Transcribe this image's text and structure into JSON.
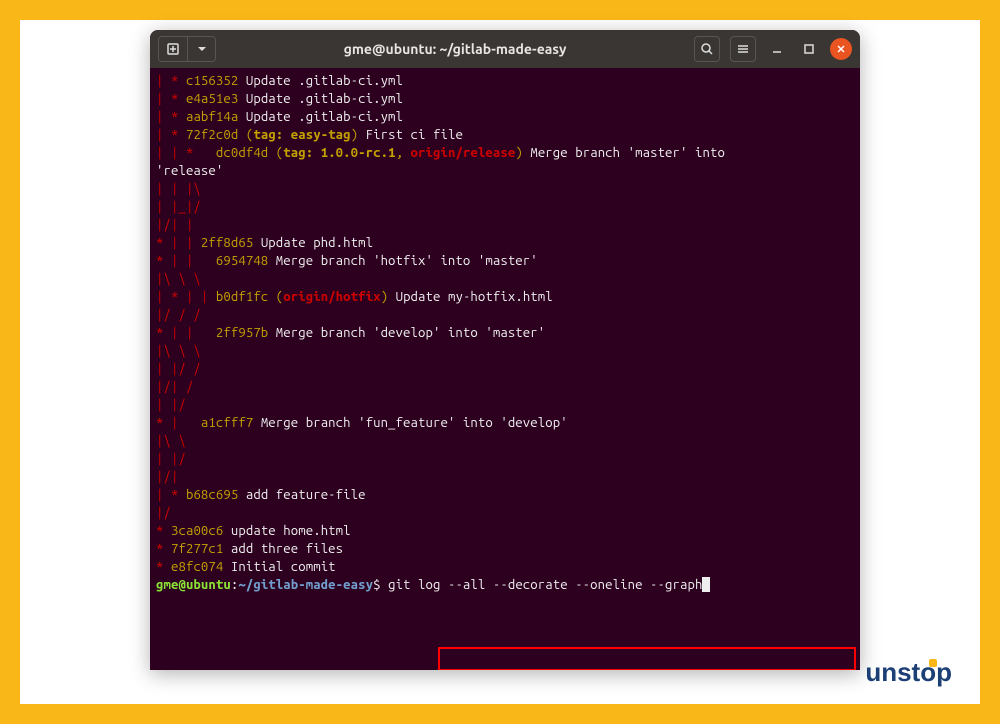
{
  "window": {
    "title": "gme@ubuntu: ~/gitlab-made-easy"
  },
  "prompt": {
    "user_host": "gme@ubuntu",
    "sep": ":",
    "path": "~/gitlab-made-easy",
    "dollar": "$",
    "command": " git log --all --decorate --oneline --graph"
  },
  "log": {
    "l1_graph": "| * ",
    "l1_hash": "c156352",
    "l1_msg": " Update .gitlab-ci.yml",
    "l2_graph": "| * ",
    "l2_hash": "e4a51e3",
    "l2_msg": " Update .gitlab-ci.yml",
    "l3_graph": "| * ",
    "l3_hash": "aabf14a",
    "l3_msg": " Update .gitlab-ci.yml",
    "l4_graph": "| * ",
    "l4_hash": "72f2c0d",
    "l4_paren_open": " (",
    "l4_tag_lbl": "tag: easy-tag",
    "l4_paren_close": ")",
    "l4_msg": " First ci file",
    "l5_graph": "| | *   ",
    "l5_hash": "dc0df4d",
    "l5_paren_open": " (",
    "l5_tag_lbl": "tag: 1.0.0-rc.1",
    "l5_comma": ", ",
    "l5_remote": "origin/release",
    "l5_paren_close": ")",
    "l5_msg": " Merge branch 'master' into ",
    "l5b_msg": "'release'",
    "l6": "| | |\\  ",
    "l7": "| |_|/  ",
    "l8": "|/| |   ",
    "l9_graph": "* | | ",
    "l9_hash": "2ff8d65",
    "l9_msg": " Update phd.html",
    "l10_graph": "* | |   ",
    "l10_hash": "6954748",
    "l10_msg": " Merge branch 'hotfix' into 'master'",
    "l11": "|\\ \\ \\  ",
    "l12_graph": "| * | | ",
    "l12_hash": "b0df1fc",
    "l12_paren_open": " (",
    "l12_remote": "origin/hotfix",
    "l12_paren_close": ")",
    "l12_msg": " Update my-hotfix.html",
    "l13": "|/ / /  ",
    "l14_graph": "* | |   ",
    "l14_hash": "2ff957b",
    "l14_msg": " Merge branch 'develop' into 'master'",
    "l15": "|\\ \\ \\  ",
    "l16": "| |/ /  ",
    "l17": "|/| /   ",
    "l18": "| |/    ",
    "l19_graph": "* |   ",
    "l19_hash": "a1cfff7",
    "l19_msg": " Merge branch 'fun_feature' into 'develop'",
    "l20": "|\\ \\  ",
    "l21": "| |/  ",
    "l22": "|/|   ",
    "l23_graph": "| * ",
    "l23_hash": "b68c695",
    "l23_msg": " add feature-file",
    "l24": "|/  ",
    "l25_graph": "* ",
    "l25_hash": "3ca00c6",
    "l25_msg": " update home.html",
    "l26_graph": "* ",
    "l26_hash": "7f277c1",
    "l26_msg": " add three files",
    "l27_graph": "* ",
    "l27_hash": "e8fc074",
    "l27_msg": " Initial commit"
  },
  "colors": {
    "red": "#cc0000",
    "green": "#4e9a06",
    "yellow": "#c4a000",
    "terminal_bg": "#2c001e",
    "titlebar_bg": "#3a3633",
    "close_btn": "#e95420"
  },
  "branding": {
    "logo_text_pre": "unst",
    "logo_text_o": "o",
    "logo_text_post": "p"
  }
}
